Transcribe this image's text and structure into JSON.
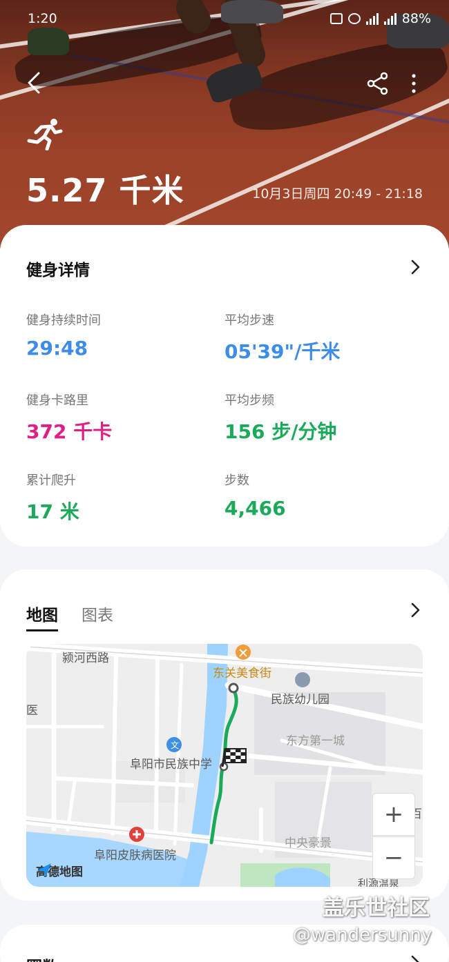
{
  "status_bar": {
    "time": "1:20",
    "battery": "88%"
  },
  "header": {
    "distance": "5.27 千米",
    "datetime": "10月3日周四 20:49 - 21:18"
  },
  "details": {
    "title": "健身详情",
    "metrics": [
      {
        "label": "健身持续时间",
        "value": "29:48",
        "color": "#3d8de8"
      },
      {
        "label": "平均步速",
        "value": "05'39\"/千米",
        "color": "#3d8de8"
      },
      {
        "label": "健身卡路里",
        "value": "372 千卡",
        "color": "#e01e87"
      },
      {
        "label": "平均步频",
        "value": "156 步/分钟",
        "color": "#1aaa5a"
      },
      {
        "label": "累计爬升",
        "value": "17 米",
        "color": "#1aaa5a"
      },
      {
        "label": "步数",
        "value": "4,466",
        "color": "#1aaa5a"
      }
    ]
  },
  "map_card": {
    "tabs": [
      {
        "label": "地图",
        "active": true
      },
      {
        "label": "图表",
        "active": false
      }
    ],
    "map_labels": {
      "road_west": "颍河西路",
      "food_street": "东关美食街",
      "kindergarten": "民族幼儿园",
      "residence": "东方第一城",
      "school": "阜阳市民族中学",
      "hospital": "阜阳皮肤病医院",
      "district": "中央豪景",
      "partial_left": "医",
      "partial_right": "百",
      "partial_bottom": "利源温泉"
    },
    "provider": "高德地图",
    "zoom_in": "+",
    "zoom_out": "−"
  },
  "laps_card": {
    "title": "圈数"
  },
  "watermark": {
    "site": "盖乐世社区",
    "user": "@wandersunny"
  },
  "colors": {
    "route": "#1aaa5a",
    "accent_blue": "#3d8de8",
    "accent_pink": "#e01e87",
    "accent_green": "#1aaa5a"
  }
}
